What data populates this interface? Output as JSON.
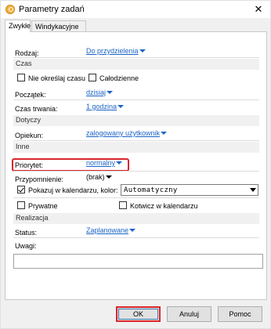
{
  "window": {
    "title": "Parametry zadań",
    "close_glyph": "✕"
  },
  "tabs": [
    {
      "label": "Zwykłe",
      "active": true
    },
    {
      "label": "Windykacyjne",
      "active": false
    }
  ],
  "form": {
    "rodzaj_label": "Rodzaj:",
    "rodzaj_value": "Do przydzielenia",
    "section_czas": "Czas",
    "nie_okreslaj_label": "Nie określaj czasu",
    "nie_okreslaj_checked": false,
    "calodzienne_label": "Całodzienne",
    "calodzienne_checked": false,
    "poczatek_label": "Początek:",
    "poczatek_value": "dzisiaj",
    "czas_trwania_label": "Czas trwania:",
    "czas_trwania_value": "1 godzina",
    "section_dotyczy": "Dotyczy",
    "opiekun_label": "Opiekun:",
    "opiekun_value": "zalogowany użytkownik",
    "section_inne": "Inne",
    "priorytet_label": "Priorytet:",
    "priorytet_value": "normalny",
    "przypomnienie_label": "Przypomnienie:",
    "przypomnienie_value": "(brak)",
    "pokazuj_label": "Pokazuj w kalendarzu, kolor:",
    "pokazuj_checked": true,
    "kolor_value": "Automatyczny",
    "prywatne_label": "Prywatne",
    "prywatne_checked": false,
    "kotwicz_label": "Kotwicz w kalendarzu",
    "kotwicz_checked": false,
    "section_realizacja": "Realizacja",
    "status_label": "Status:",
    "status_value": "Zaplanowane",
    "uwagi_label": "Uwagi:",
    "uwagi_value": ""
  },
  "buttons": {
    "ok": "OK",
    "cancel": "Anuluj",
    "help": "Pomoc"
  },
  "colors": {
    "link": "#1c64c6",
    "highlight": "#d9262c",
    "section_bg": "#f0f0f0"
  }
}
